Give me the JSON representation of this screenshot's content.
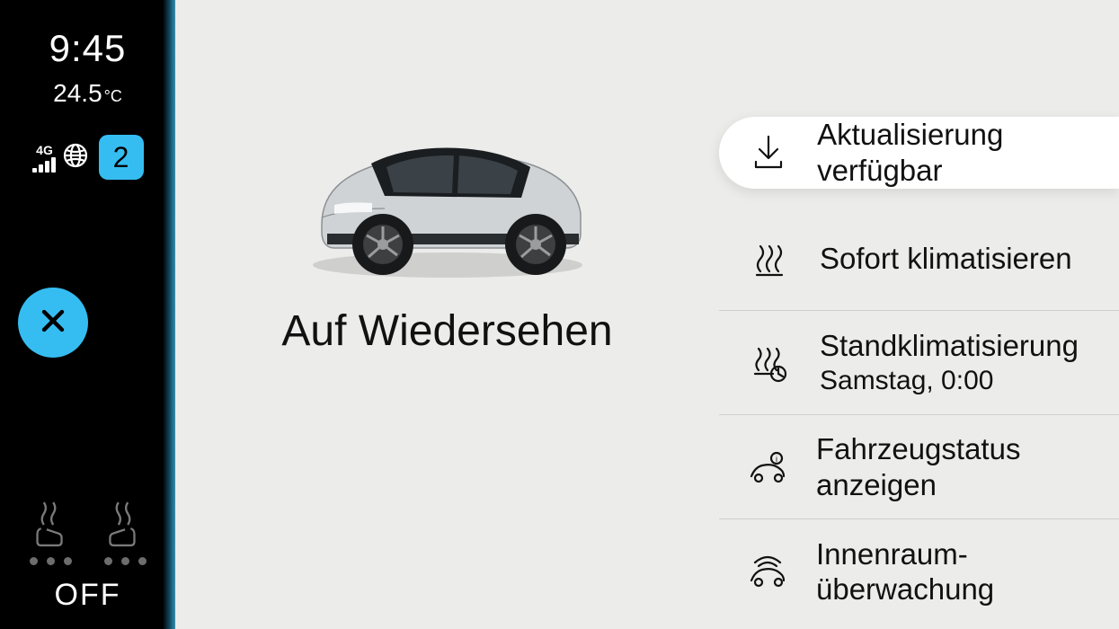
{
  "sidebar": {
    "time": "9:45",
    "temperature_value": "24.5",
    "temperature_unit": "°C",
    "network_label": "4G",
    "notification_count": "2",
    "climate_off_label": "OFF"
  },
  "main": {
    "greeting": "Auf Wiedersehen"
  },
  "menu": {
    "items": [
      {
        "label": "Aktualisierung verfügbar",
        "icon": "download-icon"
      },
      {
        "label": "Sofort klimatisieren",
        "icon": "climate-now-icon"
      },
      {
        "label": "Standklimatisierung",
        "sub": "Samstag, 0:00",
        "icon": "climate-schedule-icon"
      },
      {
        "label": "Fahrzeugstatus anzeigen",
        "icon": "vehicle-status-icon"
      },
      {
        "label": "Innenraum- überwachung",
        "icon": "interior-monitoring-icon"
      }
    ]
  }
}
